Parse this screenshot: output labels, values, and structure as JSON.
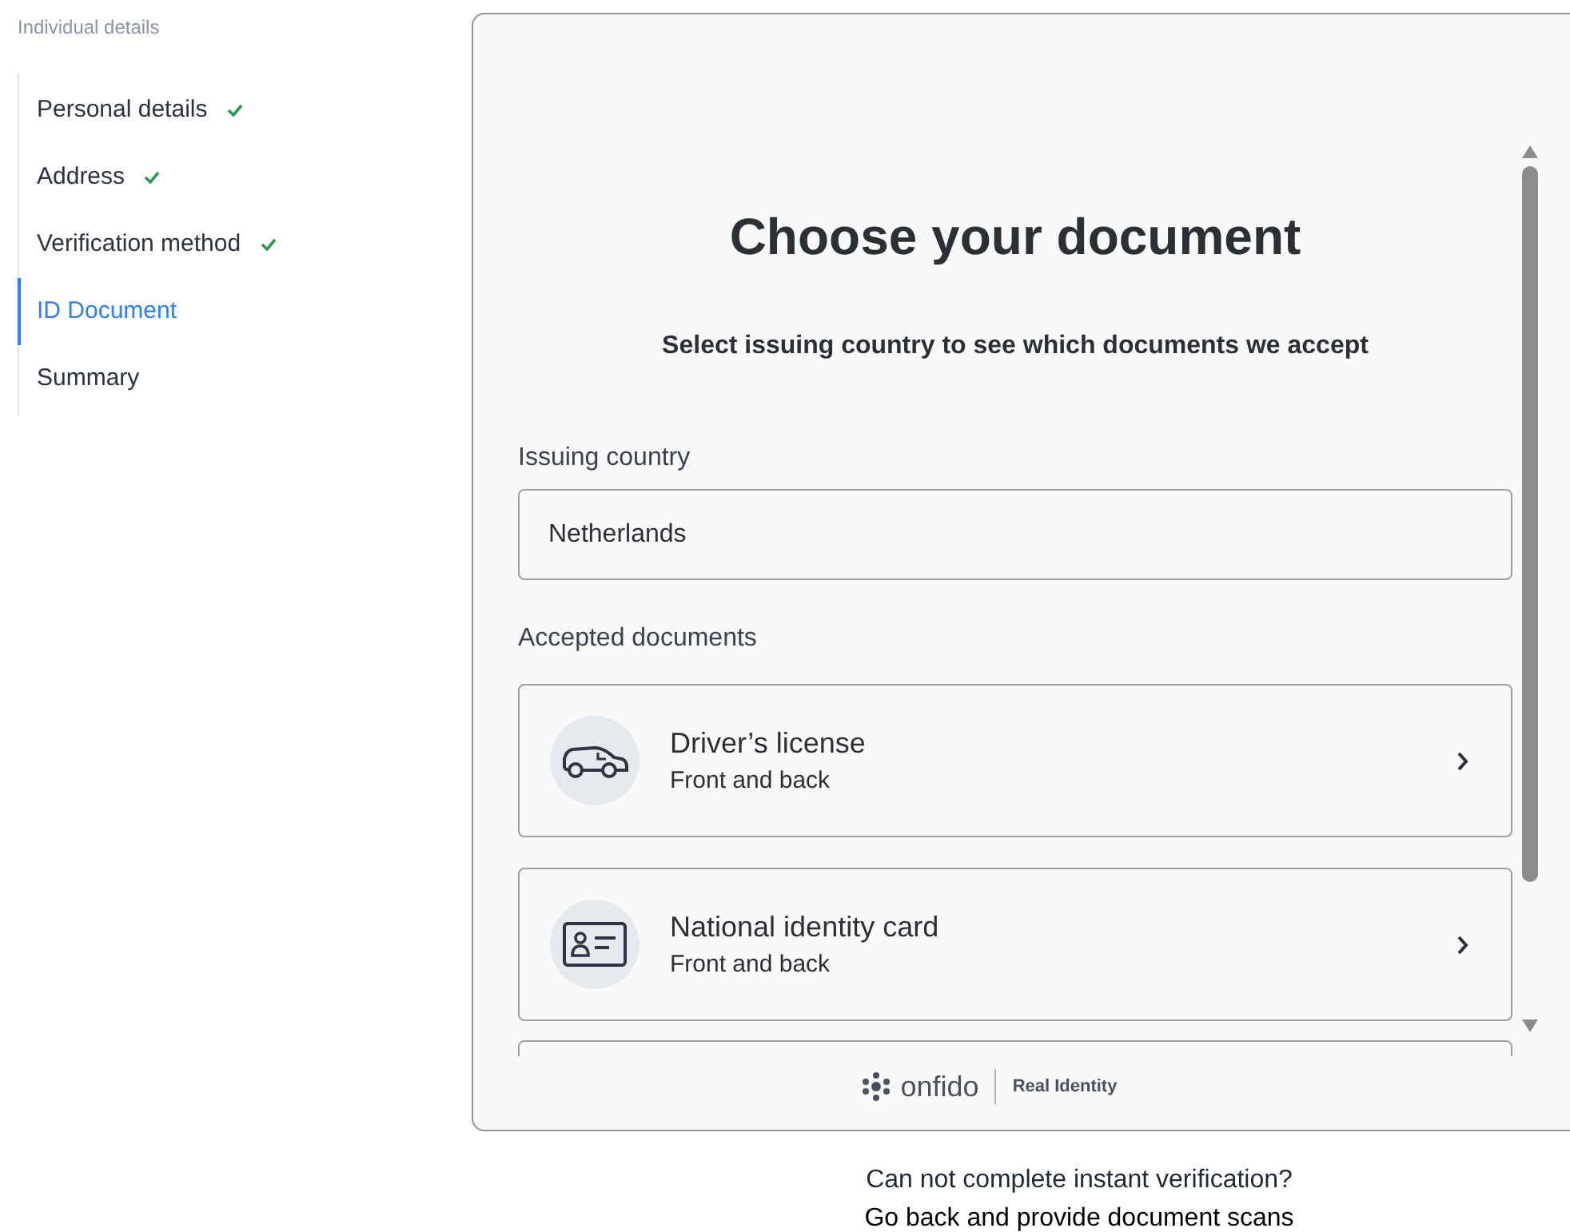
{
  "sidebar": {
    "heading": "Individual details",
    "steps": [
      {
        "label": "Personal details",
        "done": true,
        "selected": false
      },
      {
        "label": "Address",
        "done": true,
        "selected": false
      },
      {
        "label": "Verification method",
        "done": true,
        "selected": false
      },
      {
        "label": "ID Document",
        "done": false,
        "selected": true
      },
      {
        "label": "Summary",
        "done": false,
        "selected": false
      }
    ]
  },
  "panel": {
    "title": "Choose your document",
    "subtitle": "Select issuing country to see which documents we accept",
    "country_label": "Issuing country",
    "country_value": "Netherlands",
    "documents_label": "Accepted documents",
    "documents": [
      {
        "kind": "car",
        "title": "Driver’s license",
        "subtitle": "Front and back"
      },
      {
        "kind": "id_card",
        "title": "National identity card",
        "subtitle": "Front and back"
      }
    ],
    "footer": {
      "brand": "onfido",
      "tagline": "Real Identity"
    }
  },
  "help": {
    "question": "Can not complete instant verification?",
    "link": "Go back and provide document scans"
  }
}
